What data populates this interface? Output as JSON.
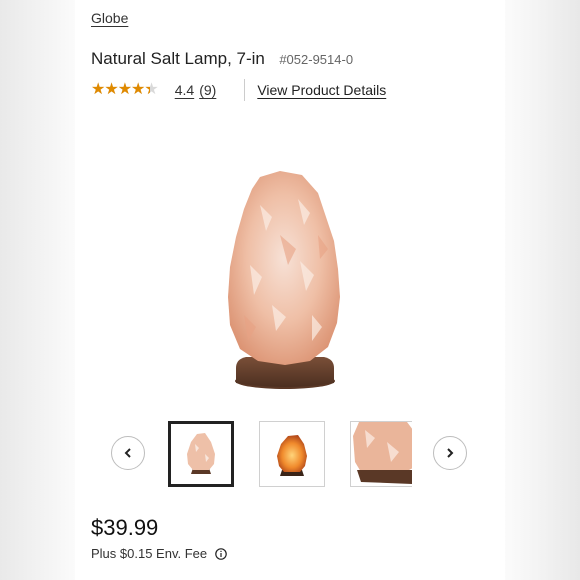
{
  "product": {
    "brand": "Globe",
    "title": "Natural Salt Lamp, 7-in",
    "sku": "#052-9514-0"
  },
  "rating": {
    "stars_glyphs": "★★★★★",
    "value": 4.4,
    "value_label": "4.4",
    "count_label": "(9)",
    "details_link": "View Product Details",
    "star_color": "#e08a00"
  },
  "gallery": {
    "main_image": "salt-lamp-photo",
    "thumbnails": [
      {
        "image": "salt-lamp-photo",
        "selected": true
      },
      {
        "image": "salt-lamp-lit-photo",
        "selected": false
      },
      {
        "image": "salt-lamp-closeup-photo",
        "selected": false
      }
    ],
    "prev_icon": "chevron-left-icon",
    "next_icon": "chevron-right-icon"
  },
  "pricing": {
    "price": "$39.99",
    "fee": "Plus $0.15 Env. Fee",
    "fee_info_icon": "info-icon"
  }
}
